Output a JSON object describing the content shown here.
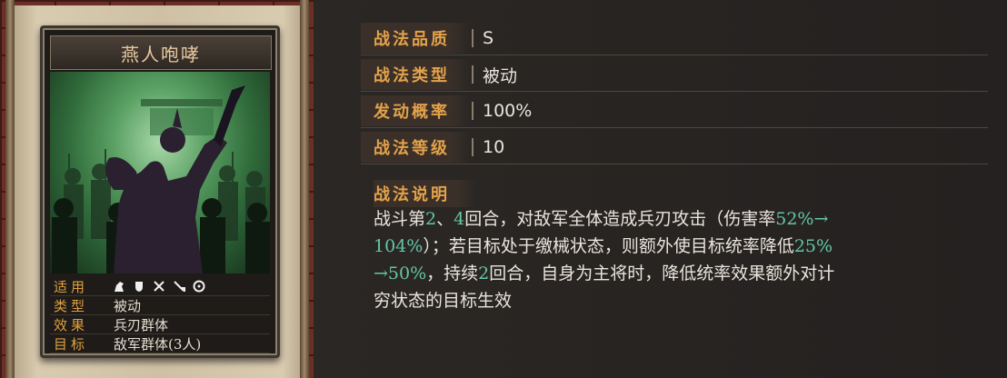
{
  "card": {
    "title": "燕人咆哮",
    "attributes": [
      {
        "label": "适用",
        "value": ""
      },
      {
        "label": "类型",
        "value": "被动"
      },
      {
        "label": "效果",
        "value": "兵刃群体"
      },
      {
        "label": "目标",
        "value": "敌军群体(3人)"
      }
    ],
    "troop_icons": [
      "cavalry-icon",
      "shield-icon",
      "bow-icon",
      "spear-icon",
      "siege-icon"
    ]
  },
  "info": {
    "rows": [
      {
        "label": "战法品质",
        "value": "S"
      },
      {
        "label": "战法类型",
        "value": "被动"
      },
      {
        "label": "发动概率",
        "value": "100%"
      },
      {
        "label": "战法等级",
        "value": "10"
      }
    ],
    "description_label": "战法说明",
    "description": {
      "line1_a": "战斗第",
      "line1_n1": "2",
      "line1_b": "、",
      "line1_n2": "4",
      "line1_c": "回合，对敌军全体造成兵刃攻击（伤害率",
      "line1_hl": "52%→",
      "line2_hl": "104%",
      "line2_a": "）；若目标处于缴械状态，则额外使目标统率降低",
      "line2_hl2": "25%",
      "line3_hl": "→50%",
      "line3_a": "，持续",
      "line3_n": "2",
      "line3_b": "回合，自身为主将时，降低统率效果额外对计",
      "line4": "穷状态的目标生效"
    }
  },
  "colors": {
    "label_orange": "#e3a24a",
    "highlight_teal": "#63c6a8",
    "text_light": "#e9e4dc"
  }
}
